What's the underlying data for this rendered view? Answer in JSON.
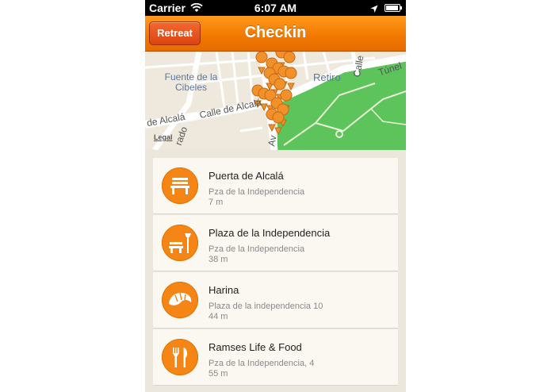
{
  "status_bar": {
    "carrier": "Carrier",
    "time": "6:07 AM"
  },
  "nav": {
    "title": "Checkin",
    "back_label": "Retreat"
  },
  "map": {
    "labels": {
      "fuente": "Fuente de la\nCibeles",
      "retiro": "Retiro",
      "tunel": "Túnel",
      "calle_alcala_1": "de Alcalá",
      "calle_alcala_2": "Calle de Alcalá",
      "calle_vertical": "Calle",
      "prado": "rado",
      "av": "Av",
      "legal": "Legal"
    },
    "colors": {
      "park": "#5cc45a",
      "road": "#ffffff",
      "pin": "#f2902a"
    }
  },
  "places": [
    {
      "name": "Puerta de Alcalá",
      "address": "Pza de la Independencia",
      "distance": "7 m",
      "icon": "bench-icon"
    },
    {
      "name": "Plaza de la Independencia",
      "address": "Pza de la Independencia",
      "distance": "38 m",
      "icon": "park-bench-lamp-icon"
    },
    {
      "name": "Harina",
      "address": "Plaza de la independencia 10",
      "distance": "44 m",
      "icon": "croissant-icon"
    },
    {
      "name": "Ramses Life & Food",
      "address": "Pza de la Independencia, 4",
      "distance": "55 m",
      "icon": "fork-knife-icon"
    }
  ],
  "accent": "#f58514"
}
